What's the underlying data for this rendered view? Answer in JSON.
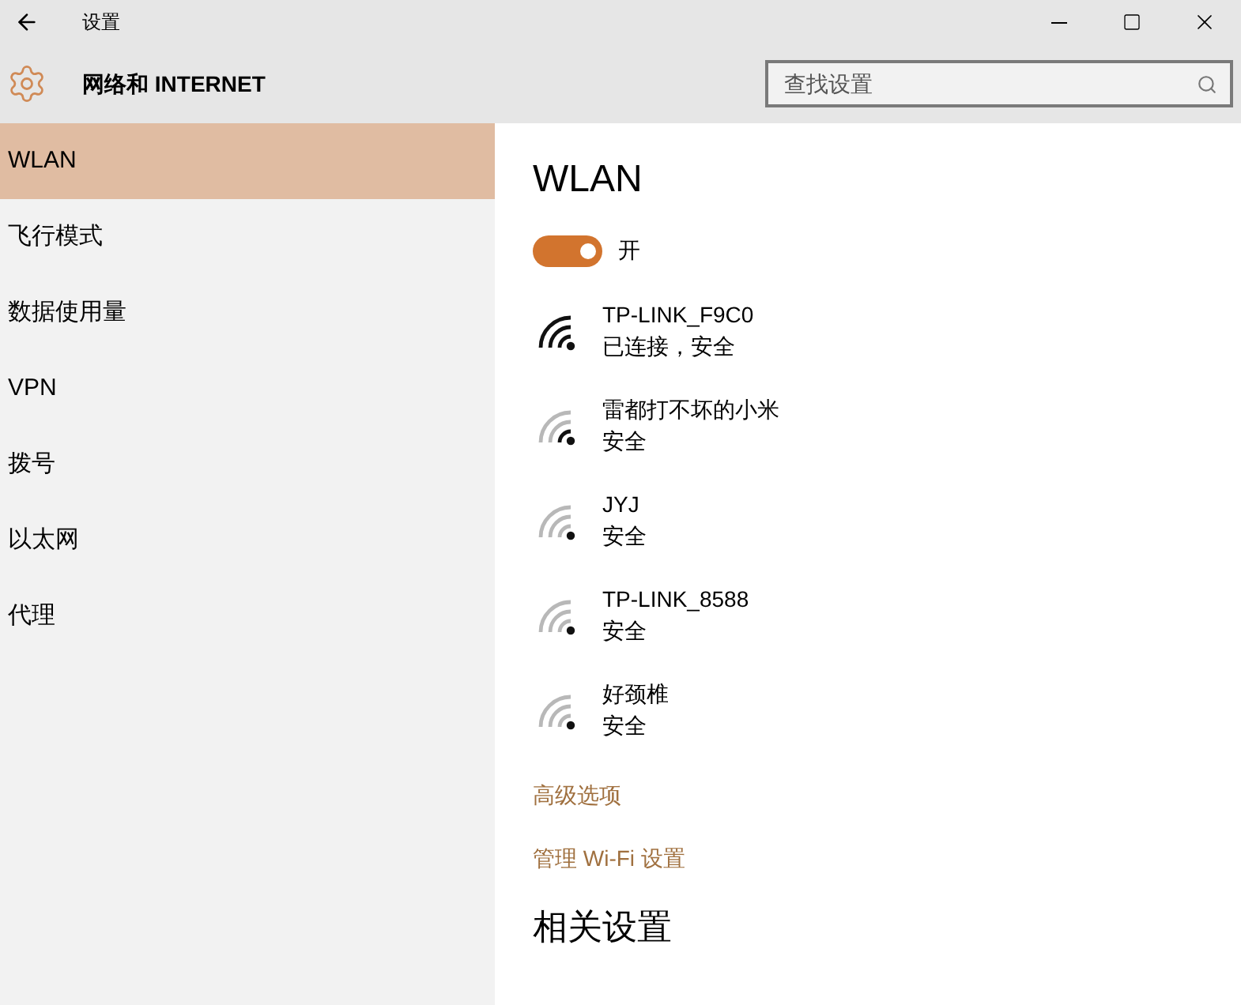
{
  "window": {
    "title": "设置"
  },
  "header": {
    "title": "网络和 INTERNET",
    "search": {
      "placeholder": "查找设置"
    }
  },
  "sidebar": {
    "items": [
      {
        "label": "WLAN",
        "selected": true
      },
      {
        "label": "飞行模式",
        "selected": false
      },
      {
        "label": "数据使用量",
        "selected": false
      },
      {
        "label": "VPN",
        "selected": false
      },
      {
        "label": "拨号",
        "selected": false
      },
      {
        "label": "以太网",
        "selected": false
      },
      {
        "label": "代理",
        "selected": false
      }
    ]
  },
  "content": {
    "title": "WLAN",
    "toggle": {
      "on": true,
      "label": "开"
    },
    "networks": [
      {
        "name": "TP-LINK_F9C0",
        "status": "已连接，安全",
        "kind": "strong"
      },
      {
        "name": "雷都打不坏的小米",
        "status": "安全",
        "kind": "medium"
      },
      {
        "name": "JYJ",
        "status": "安全",
        "kind": "weak"
      },
      {
        "name": "TP-LINK_8588",
        "status": "安全",
        "kind": "weak"
      },
      {
        "name": "好颈椎",
        "status": "安全",
        "kind": "weak"
      }
    ],
    "links": [
      "高级选项",
      "管理 Wi-Fi 设置"
    ],
    "section_title": "相关设置"
  }
}
